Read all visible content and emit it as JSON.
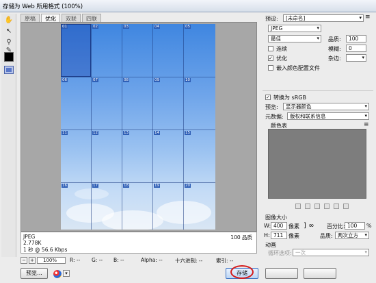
{
  "window": {
    "title": "存储为 Web 所用格式 (100%)"
  },
  "tabs": [
    "原稿",
    "优化",
    "双联",
    "四联"
  ],
  "slices": [
    "01",
    "02",
    "03",
    "04",
    "05",
    "06",
    "07",
    "08",
    "09",
    "10",
    "11",
    "12",
    "13",
    "14",
    "15",
    "16",
    "17",
    "18",
    "19",
    "20"
  ],
  "info": {
    "format": "JPEG",
    "size": "2.778K",
    "speed": "1 秒 @ 56.6 Kbps",
    "quality": "100 品质"
  },
  "status": {
    "zoom": "100%",
    "r": "R: --",
    "g": "G: --",
    "b": "B: --",
    "alpha": "Alpha: --",
    "hex": "十六进制: --",
    "index": "索引: --"
  },
  "buttons": {
    "preview": "预览...",
    "save": "存储"
  },
  "settings": {
    "preset_label": "预设:",
    "preset_value": "[未命名]",
    "format": "JPEG",
    "quality_level": "最佳",
    "quality_label": "品质:",
    "quality_value": "100",
    "progressive": "连续",
    "blur_label": "模糊:",
    "blur_value": "0",
    "optimized": "优化",
    "matte_label": "杂边:",
    "embed_profile": "嵌入颜色配置文件",
    "convert_srgb": "转换为 sRGB",
    "preview_label": "预览:",
    "preview_value": "显示器颜色",
    "metadata_label": "元数据:",
    "metadata_value": "版权和联系信息",
    "color_table": "颜色表",
    "image_size": "图像大小",
    "w_label": "W:",
    "w_value": "400",
    "h_label": "H:",
    "h_value": "711",
    "px": "像素",
    "percent_label": "百分比:",
    "percent_value": "100",
    "pct": "%",
    "quality2_label": "品质:",
    "quality2_value": "两次立方",
    "animation": "动画",
    "loop_label": "循环选项:",
    "loop_value": "一次"
  },
  "colors": {
    "accent": "#3b72c4",
    "highlight_circle": "#d41d1d"
  }
}
